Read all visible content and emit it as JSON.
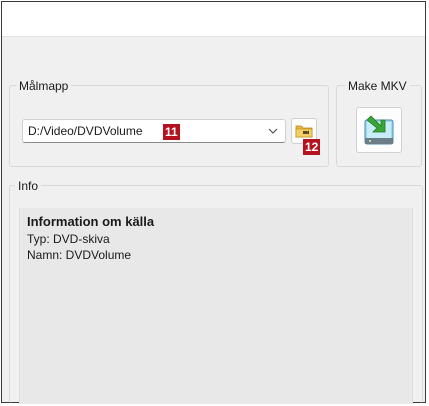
{
  "target_folder": {
    "legend": "Målmapp",
    "path_value": "D:/Video/DVDVolume",
    "callout_path": "11",
    "callout_browse": "12"
  },
  "make_mkv": {
    "legend": "Make MKV"
  },
  "info": {
    "legend": "Info",
    "heading": "Information om källa",
    "type_line": "Typ: DVD-skiva",
    "name_line": "Namn: DVDVolume"
  },
  "icons": {
    "browse": "folder-icon",
    "make_mkv": "make-mkv-icon",
    "dropdown": "chevron-down-icon"
  },
  "colors": {
    "callout": "#b3121e",
    "accent_green": "#3aa63a"
  }
}
